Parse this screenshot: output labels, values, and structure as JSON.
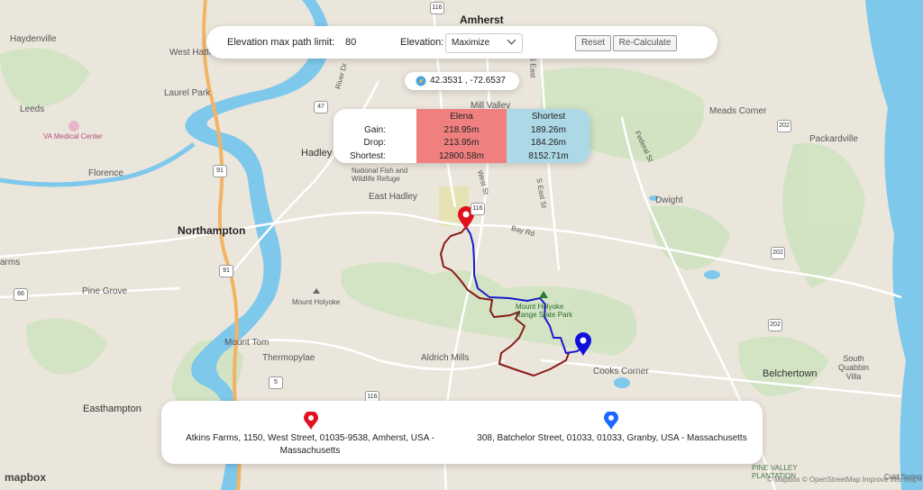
{
  "controls": {
    "elevation_limit_label": "Elevation max path limit:",
    "elevation_limit_value": "80",
    "elevation_label": "Elevation:",
    "elevation_mode": "Maximize",
    "reset_label": "Reset",
    "recalculate_label": "Re-Calculate"
  },
  "coordinates": {
    "text": "42.3531 , -72.6537"
  },
  "stats": {
    "row_labels": [
      "Gain:",
      "Drop:",
      "Shortest:"
    ],
    "elena": {
      "header": "Elena",
      "gain": "218.95m",
      "drop": "213.95m",
      "shortest": "12800.58m",
      "color": "#f08080"
    },
    "shortest": {
      "header": "Shortest",
      "gain": "189.26m",
      "drop": "184.26m",
      "shortest": "8152.71m",
      "color": "#add8e6"
    }
  },
  "addresses": {
    "start": "Atkins Farms, 1150, West Street, 01035-9538, Amherst, USA - Massachusetts",
    "end": "308, Batchelor Street, 01033, 01033, Granby, USA - Massachusetts"
  },
  "map": {
    "places": {
      "amherst": "Amherst",
      "hadley": "Hadley",
      "northampton": "Northampton",
      "easthampton": "Easthampton",
      "belchertown": "Belchertown",
      "florence": "Florence",
      "leeds": "Leeds",
      "haydenville": "Haydenville",
      "west_hatfield": "West Hatfie",
      "laurel_park": "Laurel Park",
      "va": "VA Medical Center",
      "pine_grove": "Pine Grove",
      "mount_tom": "Mount Tom",
      "thermopylae": "Thermopylae",
      "aldrich_mills": "Aldrich Mills",
      "cooks_corner": "Cooks Corner",
      "dwight": "Dwight",
      "meads_corner": "Meads Corner",
      "packardville": "Packardville",
      "mill_valley": "Mill Valley",
      "east_hadley": "East Hadley",
      "south_quabbin": "South\nQuabbin\nVilla",
      "mount_holyoke": "Mount Holyoke",
      "mt_holyoke_park": "Mount Holyoke\nRange State Park",
      "refuge": "National Fish and\nWildlife Refuge",
      "pine_valley": "PINE VALLEY\nPLANTATION",
      "arms": "arms",
      "cold_spring": "Cold Spring",
      "bay_rd": "Bay Rd",
      "west_st": "West St",
      "south_east_st": "S East St",
      "east_st": "S East",
      "federal_st": "Federal St",
      "river_dr": "River Dr"
    },
    "highways": [
      "116",
      "47",
      "91",
      "91",
      "66",
      "5",
      "116",
      "116",
      "202",
      "202",
      "202"
    ],
    "route_colors": {
      "elena": "#8b1a1a",
      "shortest": "#1a1acc",
      "start_pin": "#e0101e",
      "end_pin": "#1010dd"
    },
    "mapbox_logo": "mapbox",
    "attribution": "© Mapbox © OpenStreetMap Improve this map"
  },
  "icons": {
    "compass": "compass-icon",
    "start": "map-pin-red-icon",
    "end": "map-pin-blue-icon"
  }
}
